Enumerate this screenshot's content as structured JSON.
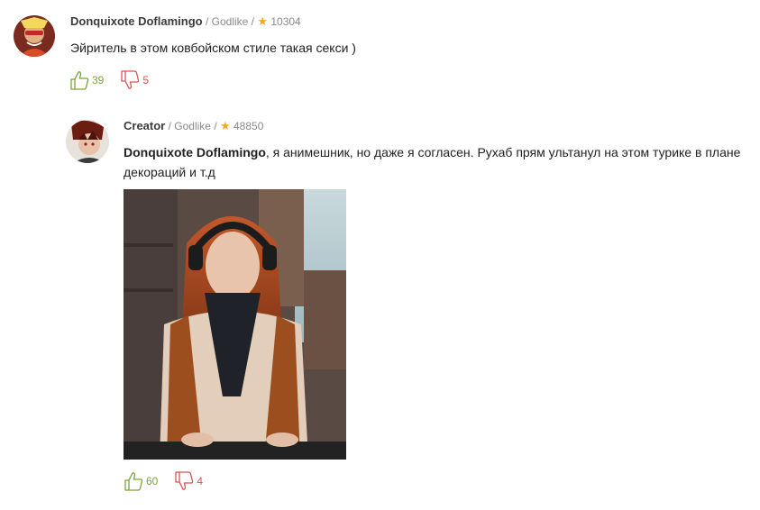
{
  "comments": [
    {
      "author": "Donquixote Doflamingo",
      "rank": "Godlike",
      "rating": "10304",
      "text": "Эйритель в этом ковбойском стиле такая секси )",
      "likes": "39",
      "dislikes": "5"
    },
    {
      "author": "Creator",
      "rank": "Godlike",
      "rating": "48850",
      "mention": "Donquixote Doflamingo",
      "text": ", я анимешник, но даже я согласен. Рухаб прям ультанул на этом турике в плане декораций и т.д",
      "likes": "60",
      "dislikes": "4"
    }
  ],
  "separator": "/",
  "icons": [
    "star-icon",
    "thumbs-up-icon",
    "thumbs-down-icon"
  ],
  "colors": {
    "like": "#7aa33b",
    "dislike": "#d9534f",
    "star": "#f5a623"
  }
}
